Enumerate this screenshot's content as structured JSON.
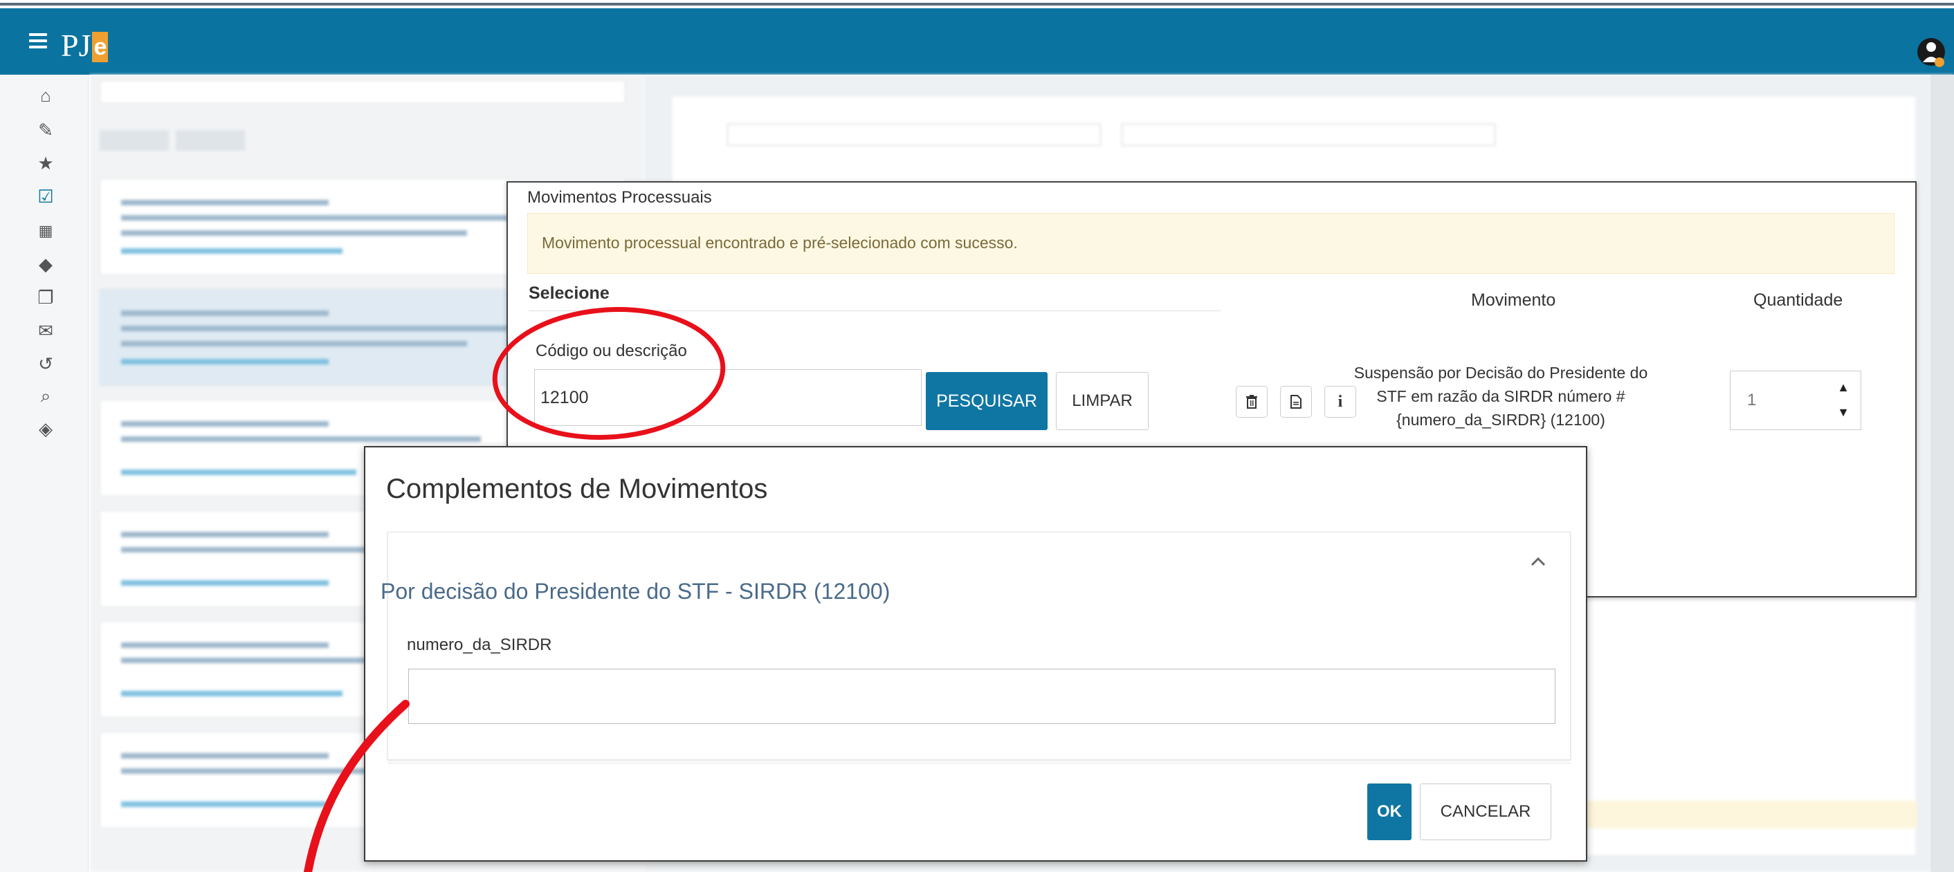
{
  "app": {
    "logo_text": "PJ",
    "logo_letter": "e"
  },
  "movimentos_panel": {
    "title": "Movimentos Processuais",
    "alert": "Movimento processual encontrado e pré-selecionado com sucesso.",
    "select_header": "Selecione",
    "field_label": "Código ou descrição",
    "field_value": "12100",
    "search_button": "PESQUISAR",
    "clear_button": "LIMPAR",
    "col_movimento": "Movimento",
    "col_quantidade": "Quantidade",
    "movimento_text": "Suspensão por Decisão do Presidente do STF em razão da SIRDR número # {numero_da_SIRDR} (12100)",
    "quantidade_value": "1"
  },
  "complementos_dialog": {
    "title": "Complementos de Movimentos",
    "subtitle": "Por decisão do Presidente do STF - SIRDR (12100)",
    "field_label": "numero_da_SIRDR",
    "field_value": "",
    "ok_button": "OK",
    "cancel_button": "CANCELAR"
  },
  "colors": {
    "topbar": "#0a73a0",
    "primary_button": "#0f76a3",
    "alert_bg": "#fcf8e3",
    "annotation": "#e8101a"
  }
}
